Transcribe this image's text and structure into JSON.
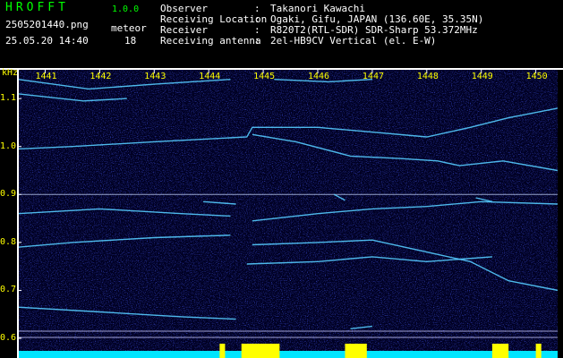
{
  "header": {
    "app_title": "HROFFT",
    "app_version": "1.0.0",
    "file_name": "2505201440.png",
    "meteor_label": "meteor",
    "timestamp": "25.05.20 14:40",
    "meteor_count": "18",
    "info": [
      {
        "label": "Observer",
        "value": "Takanori Kawachi"
      },
      {
        "label": "Receiving Location",
        "value": "Ogaki, Gifu, JAPAN (136.60E, 35.35N)"
      },
      {
        "label": "Receiver",
        "value": "R820T2(RTL-SDR) SDR-Sharp 53.372MHz"
      },
      {
        "label": "Receiving antenna",
        "value": "2el-HB9CV Vertical (el. E-W)"
      }
    ],
    "separator": ":"
  },
  "chart_data": {
    "type": "heatmap",
    "ylabel": "kHz",
    "x_ticks": [
      "1441",
      "1442",
      "1443",
      "1444",
      "1445",
      "1446",
      "1447",
      "1448",
      "1449",
      "1450"
    ],
    "y_ticks": [
      "1.1",
      "1.0",
      "0.9",
      "0.8",
      "0.7",
      "0.6"
    ],
    "xlim": [
      1440.5,
      1450.4
    ],
    "ylim": [
      0.6,
      1.16
    ],
    "colors": {
      "background": "#000033",
      "noise": "#1a2aff",
      "trace": "#55ccff",
      "bright": "#aaffee",
      "meteor_bar_base": "#00e5ff",
      "meteor_spike": "#ffff00"
    }
  }
}
